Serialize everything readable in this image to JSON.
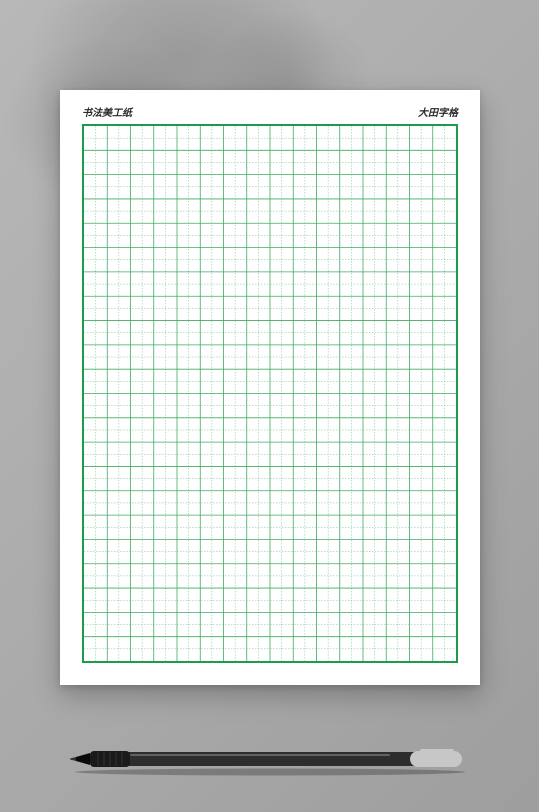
{
  "header": {
    "left": "书法美工纸",
    "right": "大田字格"
  },
  "grid": {
    "cols": 16,
    "rows": 22,
    "border_color": "#1a9c4a",
    "cell_line_color": "#3faa63",
    "guide_line_color": "#6fc08a"
  },
  "pen": {
    "body_color": "#2d2d2d",
    "grip_color": "#1a1a1a",
    "tip_color": "#0a0a0a",
    "clip_color": "#c7c7c7"
  }
}
